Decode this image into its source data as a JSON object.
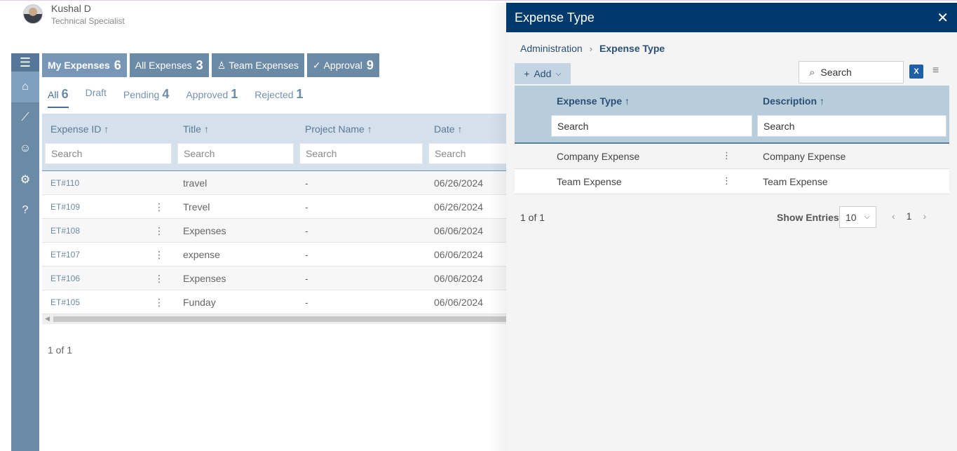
{
  "user": {
    "name": "Kushal D",
    "role": "Technical Specialist"
  },
  "rail": {
    "items": [
      "menu-icon",
      "home-icon",
      "chart-icon",
      "user-settings-icon",
      "gear-icon",
      "help-icon"
    ]
  },
  "tabs": [
    {
      "label": "My Expenses",
      "count": "6"
    },
    {
      "label": "All Expenses",
      "count": "3"
    },
    {
      "label": "Team Expenses",
      "count": ""
    },
    {
      "label": "Approval",
      "count": "9"
    }
  ],
  "subtabs": [
    {
      "label": "All",
      "count": "6"
    },
    {
      "label": "Draft",
      "count": ""
    },
    {
      "label": "Pending",
      "count": "4"
    },
    {
      "label": "Approved",
      "count": "1"
    },
    {
      "label": "Rejected",
      "count": "1"
    }
  ],
  "grid": {
    "columns": [
      "Expense ID ↑",
      "Title ↑",
      "Project Name ↑",
      "Date ↑"
    ],
    "search_placeholder": "Search",
    "rows": [
      {
        "id": "ET#110",
        "title": "travel",
        "project": "-",
        "date": "06/26/2024"
      },
      {
        "id": "ET#109",
        "title": "Trevel",
        "project": "-",
        "date": "06/26/2024"
      },
      {
        "id": "ET#108",
        "title": "Expenses",
        "project": "-",
        "date": "06/06/2024"
      },
      {
        "id": "ET#107",
        "title": "expense",
        "project": "-",
        "date": "06/06/2024"
      },
      {
        "id": "ET#106",
        "title": "Expenses",
        "project": "-",
        "date": "06/06/2024"
      },
      {
        "id": "ET#105",
        "title": "Funday",
        "project": "-",
        "date": "06/06/2024"
      }
    ],
    "pager": "1 of 1"
  },
  "panel": {
    "title": "Expense Type",
    "close": "✕",
    "breadcrumb": {
      "parent": "Administration",
      "current": "Expense Type"
    },
    "add_label": "Add",
    "search_label": "Search",
    "columns": [
      "Expense Type ↑",
      "Description ↑"
    ],
    "search_placeholder": "Search",
    "rows": [
      {
        "type": "Company Expense",
        "description": "Company Expense"
      },
      {
        "type": "Team Expense",
        "description": "Team Expense"
      }
    ],
    "pager": {
      "count": "1 of 1",
      "show_entries": "Show Entries",
      "entries_value": "10",
      "page": "1"
    }
  },
  "colors": {
    "rail": "#6b8aa6",
    "panel_header": "#003a6c",
    "grid_header": "#d4e1ec"
  }
}
